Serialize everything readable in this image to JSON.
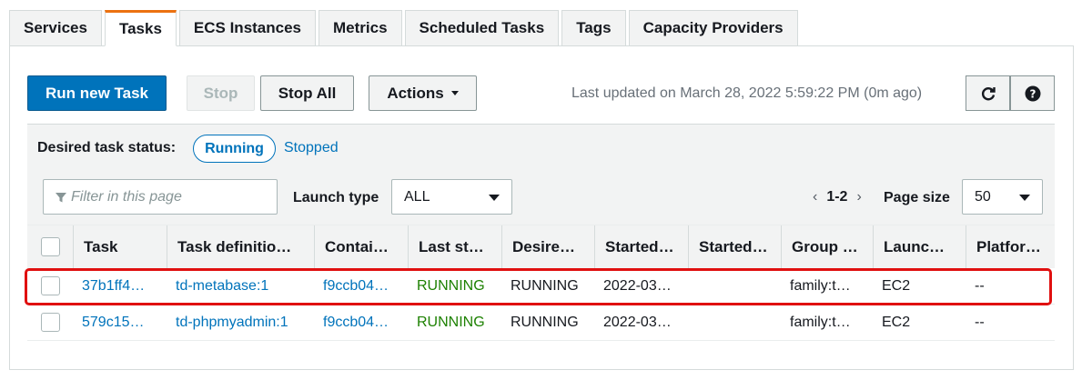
{
  "tabs": [
    "Services",
    "Tasks",
    "ECS Instances",
    "Metrics",
    "Scheduled Tasks",
    "Tags",
    "Capacity Providers"
  ],
  "active_tab": "Tasks",
  "toolbar": {
    "run_new_task": "Run new Task",
    "stop": "Stop",
    "stop_all": "Stop All",
    "actions": "Actions",
    "last_updated": "Last updated on March 28, 2022 5:59:22 PM (0m ago)",
    "refresh_icon": "refresh-icon",
    "help_icon": "help-icon"
  },
  "status_filter": {
    "label": "Desired task status:",
    "running": "Running",
    "stopped": "Stopped"
  },
  "filter": {
    "placeholder": "Filter in this page",
    "launch_type_label": "Launch type",
    "launch_type_value": "ALL",
    "pager_range": "1-2",
    "prev": "‹",
    "next": "›",
    "page_size_label": "Page size",
    "page_size_value": "50"
  },
  "table": {
    "columns": [
      "Task",
      "Task definitio…",
      "Contai…",
      "Last st…",
      "Desire…",
      "Started…",
      "Started…",
      "Group …",
      "Launc…",
      "Platfor…"
    ],
    "rows": [
      [
        "37b1ff4…",
        "td-metabase:1",
        "f9ccb04…",
        "RUNNING",
        "RUNNING",
        "2022-03…",
        "",
        "family:t…",
        "EC2",
        "--"
      ],
      [
        "579c15…",
        "td-phpmyadmin:1",
        "f9ccb04…",
        "RUNNING",
        "RUNNING",
        "2022-03…",
        "",
        "family:t…",
        "EC2",
        "--"
      ]
    ]
  },
  "colors": {
    "primary": "#0073bb",
    "running_green": "#1d8102",
    "highlight_red": "#e01010",
    "tab_accent": "#ec7211"
  }
}
